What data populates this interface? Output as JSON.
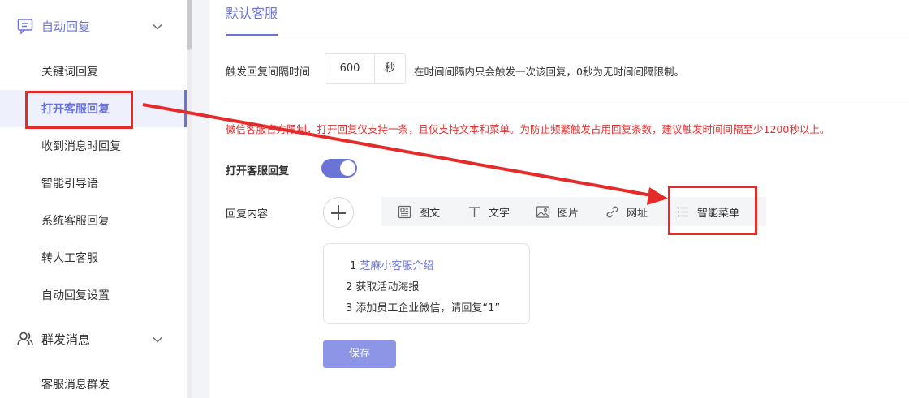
{
  "sidebar": {
    "auto_reply_group": {
      "label": "自动回复",
      "icon": "chat-icon"
    },
    "items": [
      {
        "label": "关键词回复"
      },
      {
        "label": "打开客服回复"
      },
      {
        "label": "收到消息时回复"
      },
      {
        "label": "智能引导语"
      },
      {
        "label": "系统客服回复"
      },
      {
        "label": "转人工客服"
      },
      {
        "label": "自动回复设置"
      }
    ],
    "mass_group": {
      "label": "群发消息",
      "icon": "users-icon"
    },
    "mass_items": [
      {
        "label": "客服消息群发"
      }
    ]
  },
  "main": {
    "tab": {
      "label": "默认客服"
    },
    "interval": {
      "label": "触发回复间隔时间",
      "value": "600",
      "unit": "秒",
      "hint": "在时间间隔内只会触发一次该回复，0秒为无时间间隔限制。"
    },
    "warning": "微信客服官方限制，打开回复仅支持一条，且仅支持文本和菜单。为防止频繁触发占用回复条数，建议触发时间间隔至少1200秒以上。",
    "toggle": {
      "label": "打开客服回复",
      "on": true
    },
    "content": {
      "label": "回复内容",
      "types": [
        {
          "label": "图文",
          "icon": "article-icon"
        },
        {
          "label": "文字",
          "icon": "text-icon"
        },
        {
          "label": "图片",
          "icon": "image-icon"
        },
        {
          "label": "网址",
          "icon": "link-icon"
        },
        {
          "label": "智能菜单",
          "icon": "list-icon"
        }
      ]
    },
    "menu": {
      "line1_num": "1",
      "line1_link": "芝麻小客服介绍",
      "line2": "2 获取活动海报",
      "line3": "3 添加员工企业微信，请回复“1”"
    },
    "save_label": "保存"
  },
  "colors": {
    "accent": "#6b74d6",
    "warning": "#e0312f",
    "annotation": "#e52a2a"
  }
}
